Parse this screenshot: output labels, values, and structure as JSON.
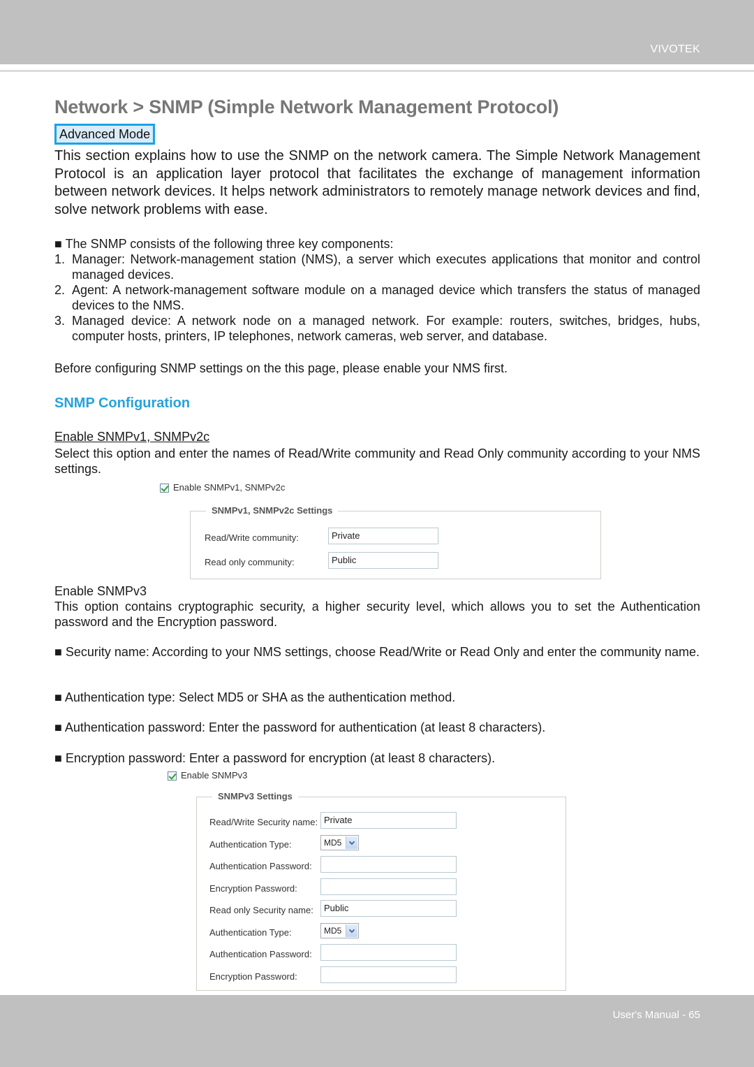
{
  "header": {
    "brand": "VIVOTEK"
  },
  "title": "Network > SNMP (Simple Network Management Protocol)",
  "mode_badge": "Advanced Mode",
  "intro": "This section explains how to use the SNMP on the network camera. The Simple Network Management Protocol is an application layer protocol that facilitates the exchange of management information between network devices. It helps network administrators to remotely manage network devices and find, solve network problems with ease.",
  "components": {
    "lead": "■ The SNMP consists of the following three key components:",
    "items": [
      {
        "n": "1.",
        "text": "Manager: Network-management station (NMS), a server which executes applications that monitor and control managed devices."
      },
      {
        "n": "2.",
        "text": "Agent: A network-management software module on a managed device which transfers the status of managed devices to the NMS."
      },
      {
        "n": "3.",
        "text": "Managed device: A network node on a managed network. For example: routers, switches, bridges, hubs, computer hosts, printers, IP telephones, network cameras, web server, and database."
      }
    ]
  },
  "before_note": "Before configuring SNMP settings on the this page, please enable your NMS first.",
  "section_heading": "SNMP Configuration",
  "v1v2": {
    "subheading": "Enable SNMPv1, SNMPv2c",
    "description": "Select this option and enter the names of Read/Write community and Read Only community according to your NMS settings.",
    "checkbox_label": "Enable SNMPv1, SNMPv2c",
    "checked": true,
    "legend": "SNMPv1, SNMPv2c Settings",
    "fields": [
      {
        "label": "Read/Write community:",
        "value": "Private"
      },
      {
        "label": "Read only community:",
        "value": "Public"
      }
    ]
  },
  "v3": {
    "subheading": "Enable SNMPv3",
    "description": "This option contains cryptographic security, a higher security level, which allows you to set the Authentication password and the Encryption password.",
    "bullets": [
      "■ Security name: According to your NMS settings, choose Read/Write or Read Only and enter the community name.",
      "■ Authentication type: Select MD5 or SHA as the authentication method.",
      "■ Authentication password: Enter the password for authentication (at least 8 characters).",
      "■ Encryption password: Enter a password for encryption (at least 8 characters)."
    ],
    "checkbox_label": "Enable SNMPv3",
    "checked": true,
    "legend": "SNMPv3 Settings",
    "fields": [
      {
        "label": "Read/Write Security name:",
        "value": "Private",
        "type": "text"
      },
      {
        "label": "Authentication Type:",
        "value": "MD5",
        "type": "select"
      },
      {
        "label": "Authentication Password:",
        "value": "",
        "type": "password"
      },
      {
        "label": "Encryption Password:",
        "value": "",
        "type": "password"
      },
      {
        "label": "Read only Security name:",
        "value": "Public",
        "type": "text"
      },
      {
        "label": "Authentication Type:",
        "value": "MD5",
        "type": "select"
      },
      {
        "label": "Authentication Password:",
        "value": "",
        "type": "password"
      },
      {
        "label": "Encryption Password:",
        "value": "",
        "type": "password"
      }
    ]
  },
  "footer": {
    "text": "User's Manual - 65"
  }
}
